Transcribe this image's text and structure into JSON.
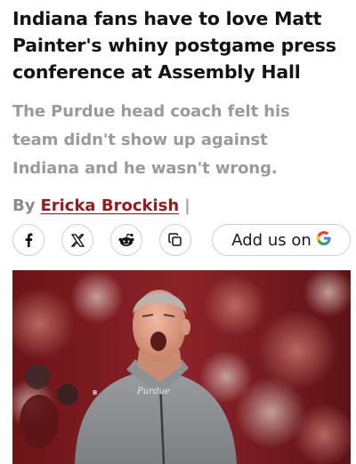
{
  "article": {
    "headline_lines": [
      "Indiana fans have to love Matt",
      "Painter's whiny postgame press",
      "conference at Assembly Hall"
    ],
    "subhead_lines": [
      "The Purdue head coach felt his",
      "team didn't show up against",
      "Indiana and he wasn't wrong."
    ],
    "byline": {
      "prefix": "By",
      "author": "Ericka Brockish",
      "separator": "|"
    }
  },
  "share": {
    "buttons": [
      {
        "icon": "facebook-icon"
      },
      {
        "icon": "x-icon"
      },
      {
        "icon": "reddit-icon"
      },
      {
        "icon": "copy-link-icon"
      }
    ],
    "google": {
      "label": "Add us on",
      "logo": "G"
    }
  },
  "hero_image": {
    "jersey_text": "Purdue",
    "colors": {
      "crowd": "#7a1e22",
      "shirt": "#8a8d90"
    }
  },
  "colors": {
    "headline": "#141414",
    "subhead": "#9a9a9a",
    "author_link": "#9a1a1a",
    "border": "#cfcfcf"
  }
}
